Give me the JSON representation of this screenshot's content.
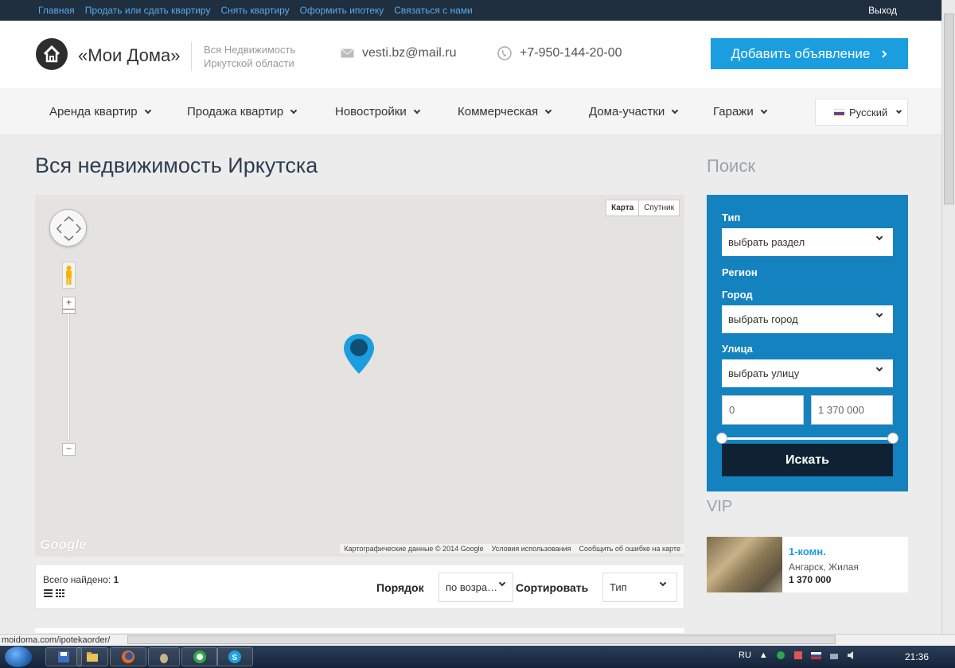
{
  "topbar": {
    "links": [
      "Главная",
      "Продать или сдать квартиру",
      "Снять квартиру",
      "Оформить ипотеку",
      "Связаться с нами"
    ],
    "exit": "Выход"
  },
  "header": {
    "logo_name": "«Мои Дома»",
    "logo_subtitle": "Вся Недвижимость Иркутской области",
    "email": "vesti.bz@mail.ru",
    "phone": "+7-950-144-20-00",
    "add_button": "Добавить объявление"
  },
  "nav": {
    "items": [
      "Аренда квартир",
      "Продажа квартир",
      "Новостройки",
      "Коммерческая",
      "Дома-участки",
      "Гаражи"
    ],
    "language": "Русский"
  },
  "main": {
    "title": "Вся недвижимость Иркутска",
    "map": {
      "type_buttons": [
        "Карта",
        "Спутник"
      ],
      "google_logo": "Google",
      "footer": [
        "Картографические данные © 2014 Google",
        "Условия использования",
        "Сообщить об ошибке на карте"
      ],
      "zoom_in": "+",
      "zoom_out": "−"
    },
    "results": {
      "found_label": "Всего найдено:",
      "found_count": "1",
      "order_label": "Порядок",
      "order_value": "по возра…",
      "sort_label": "Сортировать",
      "sort_value": "Тип"
    }
  },
  "sidebar": {
    "search_title": "Поиск",
    "type_label": "Тип",
    "type_value": "выбрать раздел",
    "region_label": "Регион",
    "city_label": "Город",
    "city_value": "выбрать город",
    "street_label": "Улица",
    "street_value": "выбрать улицу",
    "price_min": "0",
    "price_max": "1 370 000",
    "search_button": "Искать",
    "vip_title": "VIP",
    "vip_card": {
      "name": "1-комн.",
      "location": "Ангарск, Жилая",
      "price": "1 370 000"
    }
  },
  "browser": {
    "status_url": "moidoma.com/ipotekaorder/"
  },
  "taskbar": {
    "lang": "RU",
    "clock": "21:36"
  },
  "colors": {
    "accent": "#1a9ee0",
    "topbar": "#1f2f3f",
    "search_panel": "#1482bf",
    "search_button": "#0f2234"
  }
}
